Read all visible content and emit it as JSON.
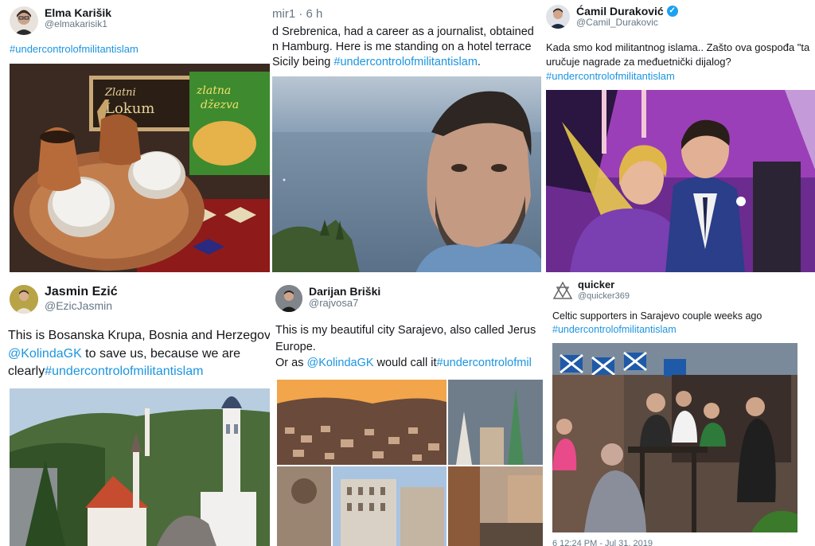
{
  "p1": {
    "name": "Elma Karišik",
    "handle": "@elmakarisik1",
    "hashtag": "#undercontrolofmilitantislam",
    "product_brand": "Zlatni Lokum",
    "product_bag": "zlatna džezva"
  },
  "p2": {
    "meta": "mir1 · 6 h",
    "line1": "d Srebrenica, had a career as a journalist, obtained",
    "line2": "n Hamburg. Here is me standing on a hotel terrace",
    "line3_prefix": "Sicily being ",
    "hashtag": "#undercontrolofmilitantislam",
    "line3_suffix": "."
  },
  "p3": {
    "name": "Ćamil Duraković",
    "handle": "@Camil_Durakovic",
    "line1": "Kada smo kod militantnog islama.. Zašto ova gospođa \"ta",
    "line2": "uručuje nagrade za međuetnički dijalog?",
    "hashtag": "#undercontrolofmilitantislam"
  },
  "p4": {
    "name": "Jasmin Ezić",
    "handle": "@EzicJasmin",
    "line1": "This is Bosanska Krupa, Bosnia and Herzegov",
    "mention": "@KolindaGK",
    "line2_suffix": " to save us, because we are",
    "line3_prefix": "clearly",
    "hashtag": "#undercontrolofmilitantislam"
  },
  "p5": {
    "name": "Darijan Briški",
    "handle": "@rajvosa7",
    "line1": "This is my beautiful city Sarajevo, also called Jerus",
    "line2": "Europe.",
    "line3_prefix": "Or as ",
    "mention": "@KolindaGK",
    "line3_mid": " would call it",
    "hashtag": "#undercontrolofmil"
  },
  "p6": {
    "name": "quicker",
    "handle": "@quicker369",
    "line1": "Celtic supporters in Sarajevo couple weeks ago",
    "hashtag": "#undercontrolofmilitantislam",
    "footer": "6 12:24 PM - Jul 31, 2019"
  },
  "colors": {
    "link": "#1b95e0",
    "verified": "#1da1f2",
    "muted": "#657786"
  }
}
